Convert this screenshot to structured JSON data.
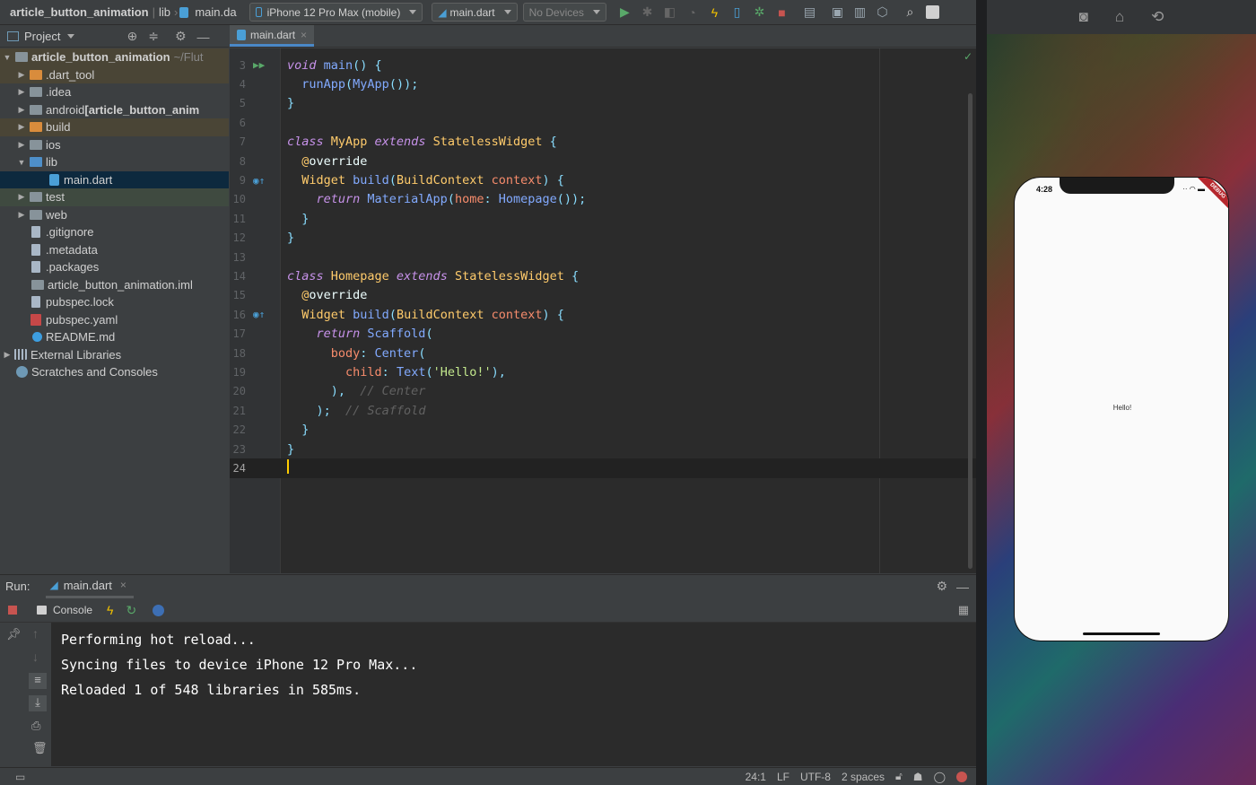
{
  "topbar": {
    "project": "article_button_animation",
    "crumb_lib": "lib",
    "crumb_file": "main.da",
    "device_combo": "iPhone 12 Pro Max (mobile)",
    "config_combo": "main.dart",
    "devices_combo": "No Devices"
  },
  "project_panel": {
    "title": "Project",
    "rows": [
      {
        "label": "article_button_animation",
        "suffix": "~/Flut"
      },
      {
        "label": ".dart_tool"
      },
      {
        "label": ".idea"
      },
      {
        "label": "android ",
        "suffix_bold": "[article_button_anim"
      },
      {
        "label": "build"
      },
      {
        "label": "ios"
      },
      {
        "label": "lib"
      },
      {
        "label": "main.dart"
      },
      {
        "label": "test"
      },
      {
        "label": "web"
      },
      {
        "label": ".gitignore"
      },
      {
        "label": ".metadata"
      },
      {
        "label": ".packages"
      },
      {
        "label": "article_button_animation.iml"
      },
      {
        "label": "pubspec.lock"
      },
      {
        "label": "pubspec.yaml"
      },
      {
        "label": "README.md"
      },
      {
        "label": "External Libraries"
      },
      {
        "label": "Scratches and Consoles"
      }
    ]
  },
  "editor": {
    "tab": "main.dart",
    "lines": [
      "3",
      "4",
      "5",
      "6",
      "7",
      "8",
      "9",
      "10",
      "11",
      "12",
      "13",
      "14",
      "15",
      "16",
      "17",
      "18",
      "19",
      "20",
      "21",
      "22",
      "23",
      "24"
    ],
    "code": {
      "l3a": "void",
      "l3b": " main",
      "l3c": "() {",
      "l4a": "  runApp",
      "l4b": "(",
      "l4c": "MyApp",
      "l4d": "());",
      "l5": "}",
      "l7a": "class",
      "l7b": " MyApp ",
      "l7c": "extends",
      "l7d": " StatelessWidget",
      "l7e": " {",
      "l8a": "  @",
      "l8b": "override",
      "l9a": "  Widget",
      "l9b": " build",
      "l9c": "(",
      "l9d": "BuildContext",
      "l9e": " context",
      "l9f": ") {",
      "l10a": "    return",
      "l10b": " MaterialApp",
      "l10c": "(",
      "l10d": "home",
      "l10e": ": ",
      "l10f": "Homepage",
      "l10g": "());",
      "l11": "  }",
      "l12": "}",
      "l14a": "class",
      "l14b": " Homepage ",
      "l14c": "extends",
      "l14d": " StatelessWidget",
      "l14e": " {",
      "l15a": "  @",
      "l15b": "override",
      "l16a": "  Widget",
      "l16b": " build",
      "l16c": "(",
      "l16d": "BuildContext",
      "l16e": " context",
      "l16f": ") {",
      "l17a": "    return",
      "l17b": " Scaffold",
      "l17c": "(",
      "l18a": "      body",
      "l18b": ": ",
      "l18c": "Center",
      "l18d": "(",
      "l19a": "        child",
      "l19b": ": ",
      "l19c": "Text",
      "l19d": "(",
      "l19e": "'Hello!'",
      "l19f": "),",
      "l20a": "      ),",
      "l20b": "  // Center",
      "l21a": "    );",
      "l21b": "  // Scaffold",
      "l22": "  }",
      "l23": "}"
    }
  },
  "run": {
    "label": "Run:",
    "tab": "main.dart",
    "console_tab": "Console",
    "output": [
      "Performing hot reload...",
      "Syncing files to device iPhone 12 Pro Max...",
      "Reloaded 1 of 548 libraries in 585ms."
    ]
  },
  "status": {
    "position": "24:1",
    "line_sep": "LF",
    "encoding": "UTF-8",
    "indent": "2 spaces"
  },
  "simulator": {
    "time": "4:28",
    "debug_ribbon": "DEBUG",
    "hello_text": "Hello!"
  }
}
